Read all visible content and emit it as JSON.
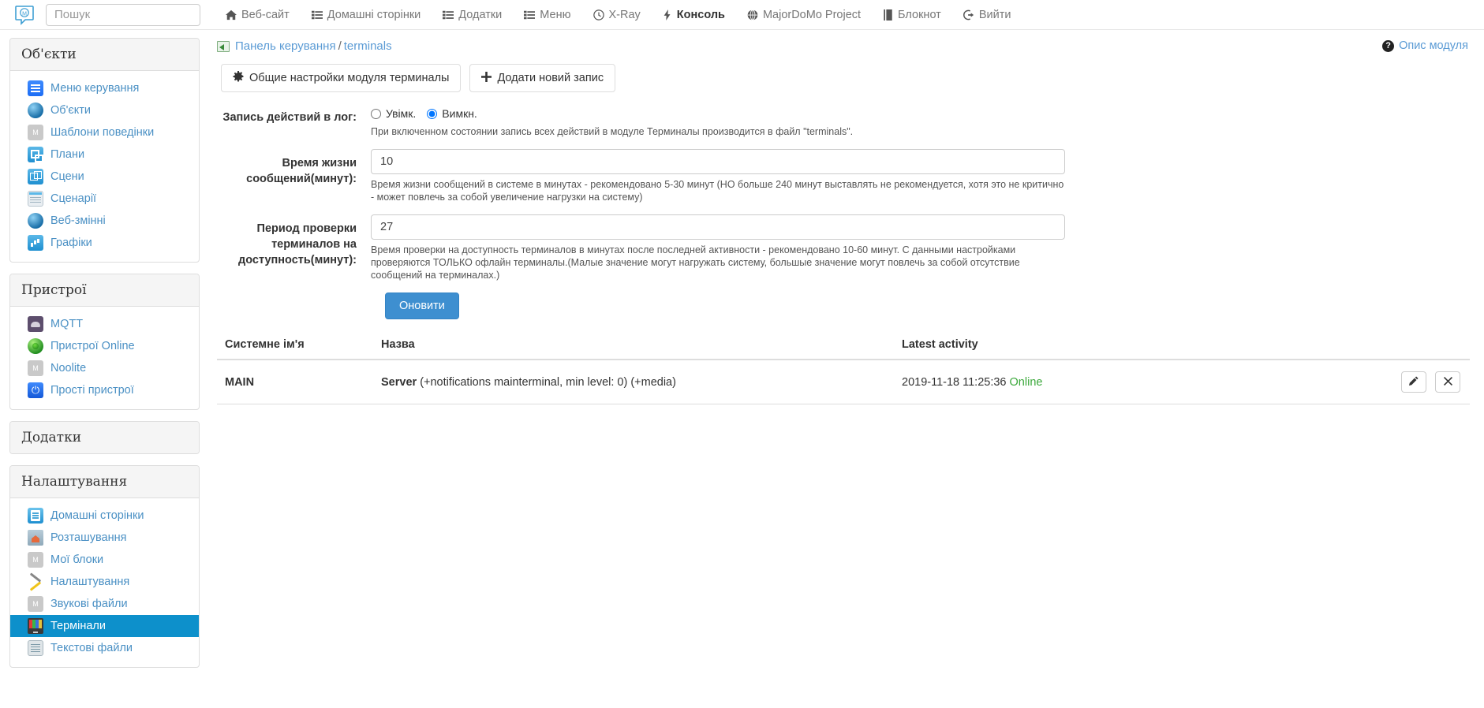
{
  "topnav": {
    "logo_icon": "majordomo-logo-icon",
    "search": {
      "placeholder": "Пошук",
      "value": ""
    },
    "items": [
      {
        "label": "Веб-сайт",
        "icon": "home-icon"
      },
      {
        "label": "Домашні сторінки",
        "icon": "list-icon"
      },
      {
        "label": "Додатки",
        "icon": "list-icon"
      },
      {
        "label": "Меню",
        "icon": "list-icon"
      },
      {
        "label": "X-Ray",
        "icon": "clock-icon"
      },
      {
        "label": "Консоль",
        "icon": "bolt-icon"
      },
      {
        "label": "MajorDoMo Project",
        "icon": "globe-icon"
      },
      {
        "label": "Блокнот",
        "icon": "book-icon"
      },
      {
        "label": "Вийти",
        "icon": "logout-icon"
      }
    ]
  },
  "sidebar": {
    "panels": [
      {
        "title": "Об'єкти",
        "collapsed": false,
        "items": [
          {
            "label": "Меню керування",
            "icon": "menu-icon",
            "cls": "ic-menu",
            "active": false
          },
          {
            "label": "Об'єкти",
            "icon": "sphere-icon",
            "cls": "ic-sphere",
            "active": false
          },
          {
            "label": "Шаблони поведінки",
            "icon": "template-icon",
            "cls": "ic-grey",
            "active": false
          },
          {
            "label": "Плани",
            "icon": "floorplan-icon",
            "cls": "ic-plan",
            "active": false
          },
          {
            "label": "Сцени",
            "icon": "scenes-icon",
            "cls": "ic-scene",
            "active": false
          },
          {
            "label": "Сценарії",
            "icon": "scripts-icon",
            "cls": "ic-script",
            "active": false
          },
          {
            "label": "Веб-змінні",
            "icon": "webvars-icon",
            "cls": "ic-webvar",
            "active": false
          },
          {
            "label": "Графіки",
            "icon": "charts-icon",
            "cls": "ic-chart",
            "active": false
          }
        ]
      },
      {
        "title": "Пристрої",
        "collapsed": false,
        "items": [
          {
            "label": "MQTT",
            "icon": "mqtt-icon",
            "cls": "ic-mqtt",
            "active": false
          },
          {
            "label": "Пристрої Online",
            "icon": "online-devices-icon",
            "cls": "ic-online",
            "active": false
          },
          {
            "label": "Noolite",
            "icon": "noolite-icon",
            "cls": "ic-grey",
            "active": false
          },
          {
            "label": "Прості пристрої",
            "icon": "simple-devices-icon",
            "cls": "ic-power",
            "active": false
          }
        ]
      },
      {
        "title": "Додатки",
        "collapsed": true,
        "items": []
      },
      {
        "title": "Налаштування",
        "collapsed": false,
        "items": [
          {
            "label": "Домашні сторінки",
            "icon": "home-pages-icon",
            "cls": "ic-doc",
            "active": false
          },
          {
            "label": "Розташування",
            "icon": "locations-icon",
            "cls": "ic-folder",
            "active": false
          },
          {
            "label": "Мої блоки",
            "icon": "my-blocks-icon",
            "cls": "ic-grey",
            "active": false
          },
          {
            "label": "Налаштування",
            "icon": "settings-icon",
            "cls": "ic-tools",
            "active": false
          },
          {
            "label": "Звукові файли",
            "icon": "sound-files-icon",
            "cls": "ic-grey",
            "active": false
          },
          {
            "label": "Термінали",
            "icon": "terminals-icon",
            "cls": "ic-terminal",
            "active": true
          },
          {
            "label": "Текстові файли",
            "icon": "text-files-icon",
            "cls": "ic-textfile",
            "active": false
          }
        ]
      }
    ]
  },
  "content": {
    "breadcrumb": {
      "root": "Панель керування",
      "sep": "/",
      "current": "terminals"
    },
    "module_description_link": "Опис модуля",
    "toolbar": {
      "settings_button": "Общие настройки модуля терминалы",
      "add_button": "Додати новий запис"
    },
    "form": {
      "log": {
        "label": "Запись действий в лог:",
        "option_on": "Увімк.",
        "option_off": "Вимкн.",
        "selected": "off",
        "help": "При включенном состоянии запись всех действий в модуле Терминалы производится в файл \"terminals\"."
      },
      "lifetime": {
        "label": "Время жизни сообщений(минут):",
        "value": "10",
        "help": "Время жизни сообщений в системе в минутах - рекомендовано 5-30 минут (НО больше 240 минут выставлять не рекомендуется, хотя это не критично - может повлечь за собой увеличение нагрузки на систему)"
      },
      "checkperiod": {
        "label": "Период проверки терминалов на доступность(минут):",
        "value": "27",
        "help": "Время проверки на доступность терминалов в минутах после последней активности - рекомендовано 10-60 минут. С данными настройками проверяются ТОЛЬКО офлайн терминалы.(Малые значение могут нагружать систему, большые значение могут повлечь за собой отсутствие сообщений на терминалах.)"
      },
      "submit_label": "Оновити"
    },
    "table": {
      "headers": [
        "Системне ім'я",
        "Назва",
        "Latest activity",
        ""
      ],
      "rows": [
        {
          "system_name": "MAIN",
          "title_bold": "Server",
          "title_rest": "(+notifications mainterminal, min level: 0) (+media)",
          "timestamp": "2019-11-18 11:25:36",
          "status": "Online",
          "edit_icon": "pencil-icon",
          "delete_icon": "close-x-icon"
        }
      ]
    }
  },
  "colors": {
    "link": "#5b9bd5",
    "active_item_bg": "#0d90cb",
    "primary_button": "#3e8fd0",
    "online_green": "#3ba83b"
  }
}
